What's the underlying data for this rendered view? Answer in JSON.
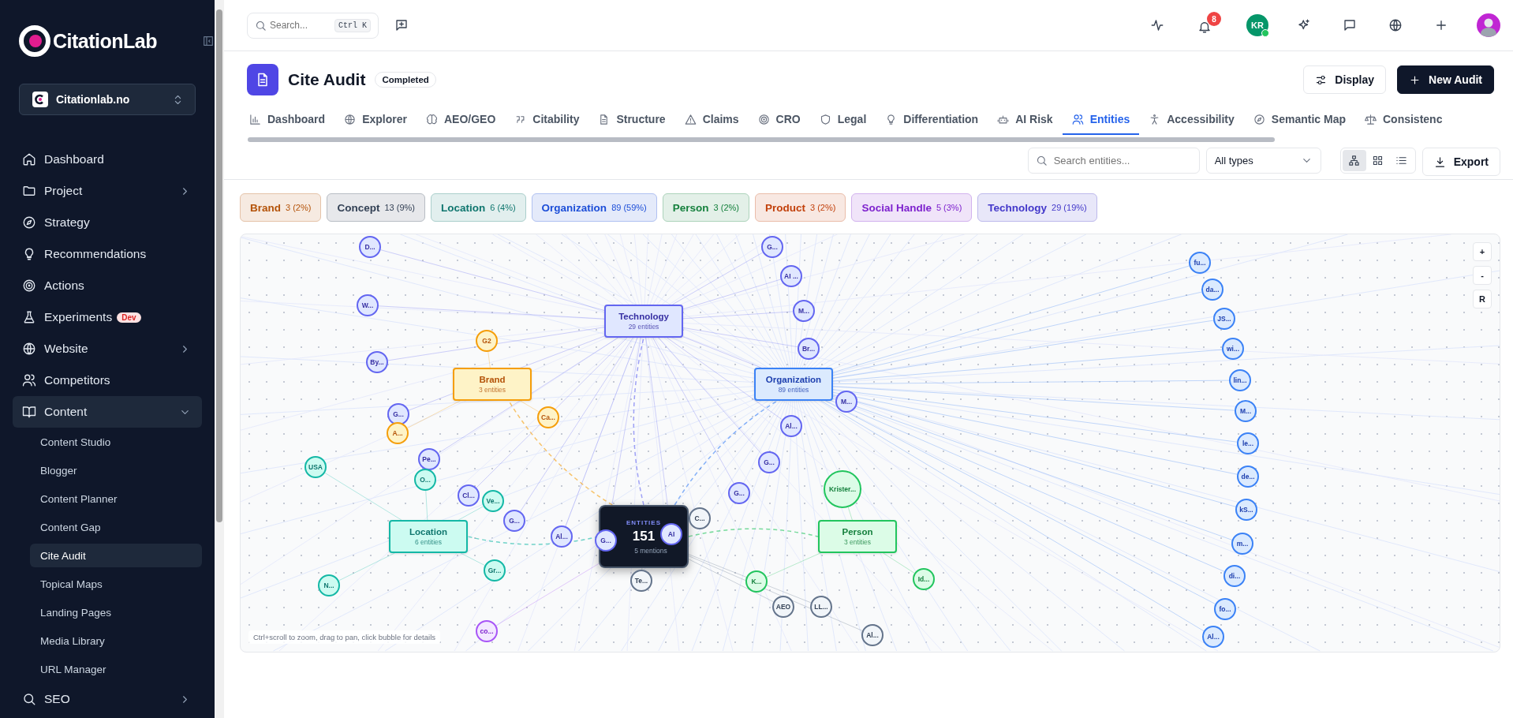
{
  "sidebar": {
    "brand": "CitationLab",
    "workspace": "Citationlab.no",
    "items": [
      {
        "label": "Dashboard",
        "kind": "link"
      },
      {
        "label": "Project",
        "kind": "group",
        "expanded": false
      },
      {
        "label": "Strategy",
        "kind": "link"
      },
      {
        "label": "Recommendations",
        "kind": "link"
      },
      {
        "label": "Actions",
        "kind": "link"
      },
      {
        "label": "Experiments",
        "kind": "link",
        "badge": "Dev"
      },
      {
        "label": "Website",
        "kind": "group",
        "expanded": false
      },
      {
        "label": "Competitors",
        "kind": "link"
      },
      {
        "label": "Content",
        "kind": "group",
        "expanded": true,
        "children": [
          {
            "label": "Content Studio",
            "selected": false
          },
          {
            "label": "Blogger",
            "selected": false
          },
          {
            "label": "Content Planner",
            "selected": false
          },
          {
            "label": "Content Gap",
            "selected": false
          },
          {
            "label": "Cite Audit",
            "selected": true
          },
          {
            "label": "Topical Maps",
            "selected": false
          },
          {
            "label": "Landing Pages",
            "selected": false
          },
          {
            "label": "Media Library",
            "selected": false
          },
          {
            "label": "URL Manager",
            "selected": false
          }
        ]
      },
      {
        "label": "SEO",
        "kind": "group",
        "expanded": false
      }
    ]
  },
  "topbar": {
    "search": {
      "placeholder": "Search...",
      "shortcut": "Ctrl K"
    },
    "notifications": "8",
    "user_initials": "KR"
  },
  "header": {
    "title": "Cite Audit",
    "status": "Completed",
    "buttons": [
      "Display",
      "New Audit"
    ]
  },
  "tabs": [
    {
      "label": "Dashboard",
      "selected": false
    },
    {
      "label": "Explorer",
      "selected": false
    },
    {
      "label": "AEO/GEO",
      "selected": false
    },
    {
      "label": "Citability",
      "selected": false
    },
    {
      "label": "Structure",
      "selected": false
    },
    {
      "label": "Claims",
      "selected": false
    },
    {
      "label": "CRO",
      "selected": false
    },
    {
      "label": "Legal",
      "selected": false
    },
    {
      "label": "Differentiation",
      "selected": false
    },
    {
      "label": "AI Risk",
      "selected": false
    },
    {
      "label": "Entities",
      "selected": true
    },
    {
      "label": "Accessibility",
      "selected": false
    },
    {
      "label": "Semantic Map",
      "selected": false
    },
    {
      "label": "Consistenc",
      "selected": false
    }
  ],
  "toolbar": {
    "search": {
      "placeholder": "Search entities..."
    },
    "type_filter": "All types",
    "view_modes": [
      {
        "selected": true
      },
      {
        "selected": false
      },
      {
        "selected": false
      }
    ],
    "export": "Export"
  },
  "chips": [
    {
      "label": "Brand",
      "count": "3 (2%)",
      "color": "#b45309"
    },
    {
      "label": "Concept",
      "count": "13 (9%)",
      "color": "#334155"
    },
    {
      "label": "Location",
      "count": "6 (4%)",
      "color": "#0f766e"
    },
    {
      "label": "Organization",
      "count": "89 (59%)",
      "color": "#1d4ed8"
    },
    {
      "label": "Person",
      "count": "3 (2%)",
      "color": "#15803d"
    },
    {
      "label": "Product",
      "count": "3 (2%)",
      "color": "#c2410c"
    },
    {
      "label": "Social Handle",
      "count": "5 (3%)",
      "color": "#7e22ce"
    },
    {
      "label": "Technology",
      "count": "29 (19%)",
      "color": "#4338ca"
    }
  ],
  "graph": {
    "center": {
      "title": "ENTITIES",
      "count": "151",
      "sub": "5 mentions"
    },
    "hubs": [
      {
        "label": "Technology",
        "sub": "29 entities",
        "kind": "technology"
      },
      {
        "label": "Brand",
        "sub": "3 entities",
        "kind": "brand"
      },
      {
        "label": "Organization",
        "sub": "89 entities",
        "kind": "organization"
      },
      {
        "label": "Location",
        "sub": "6 entities",
        "kind": "location"
      },
      {
        "label": "Person",
        "sub": "3 entities",
        "kind": "person"
      }
    ],
    "bubbles": [
      {
        "label": "D...",
        "kind": "technology"
      },
      {
        "label": "W...",
        "kind": "technology"
      },
      {
        "label": "By...",
        "kind": "technology"
      },
      {
        "label": "G2",
        "kind": "brand"
      },
      {
        "label": "G...",
        "kind": "technology"
      },
      {
        "label": "A...",
        "kind": "brand"
      },
      {
        "label": "Ca...",
        "kind": "brand"
      },
      {
        "label": "USA",
        "kind": "location"
      },
      {
        "label": "Pe...",
        "kind": "technology"
      },
      {
        "label": "O...",
        "kind": "location"
      },
      {
        "label": "Cl...",
        "kind": "technology"
      },
      {
        "label": "Ve...",
        "kind": "location"
      },
      {
        "label": "G...",
        "kind": "technology"
      },
      {
        "label": "Al...",
        "kind": "technology"
      },
      {
        "label": "Gr...",
        "kind": "location"
      },
      {
        "label": "N...",
        "kind": "location"
      },
      {
        "label": "Te...",
        "kind": "concept"
      },
      {
        "label": "co...",
        "kind": "social"
      },
      {
        "label": "G...",
        "kind": "technology"
      },
      {
        "label": "AI",
        "kind": "technology"
      },
      {
        "label": "C...",
        "kind": "concept"
      },
      {
        "label": "G...",
        "kind": "technology"
      },
      {
        "label": "AI ...",
        "kind": "technology"
      },
      {
        "label": "M...",
        "kind": "technology"
      },
      {
        "label": "Br...",
        "kind": "technology"
      },
      {
        "label": "M...",
        "kind": "technology"
      },
      {
        "label": "Al...",
        "kind": "technology"
      },
      {
        "label": "G...",
        "kind": "technology"
      },
      {
        "label": "G...",
        "kind": "technology"
      },
      {
        "label": "Krister...",
        "kind": "person"
      },
      {
        "label": "K...",
        "kind": "person"
      },
      {
        "label": "AEO",
        "kind": "concept"
      },
      {
        "label": "LL...",
        "kind": "concept"
      },
      {
        "label": "Al...",
        "kind": "concept"
      },
      {
        "label": "Id...",
        "kind": "person"
      },
      {
        "label": "fu...",
        "kind": "organization"
      },
      {
        "label": "da...",
        "kind": "organization"
      },
      {
        "label": "JS...",
        "kind": "organization"
      },
      {
        "label": "wi...",
        "kind": "organization"
      },
      {
        "label": "lin...",
        "kind": "organization"
      },
      {
        "label": "M...",
        "kind": "organization"
      },
      {
        "label": "le...",
        "kind": "organization"
      },
      {
        "label": "de...",
        "kind": "organization"
      },
      {
        "label": "kS...",
        "kind": "organization"
      },
      {
        "label": "m...",
        "kind": "organization"
      },
      {
        "label": "di...",
        "kind": "organization"
      },
      {
        "label": "fo...",
        "kind": "organization"
      },
      {
        "label": "Al...",
        "kind": "organization"
      }
    ],
    "hint": "Ctrl+scroll to zoom, drag to pan, click bubble for details",
    "zoom_controls": [
      "+",
      "-",
      "R"
    ]
  }
}
